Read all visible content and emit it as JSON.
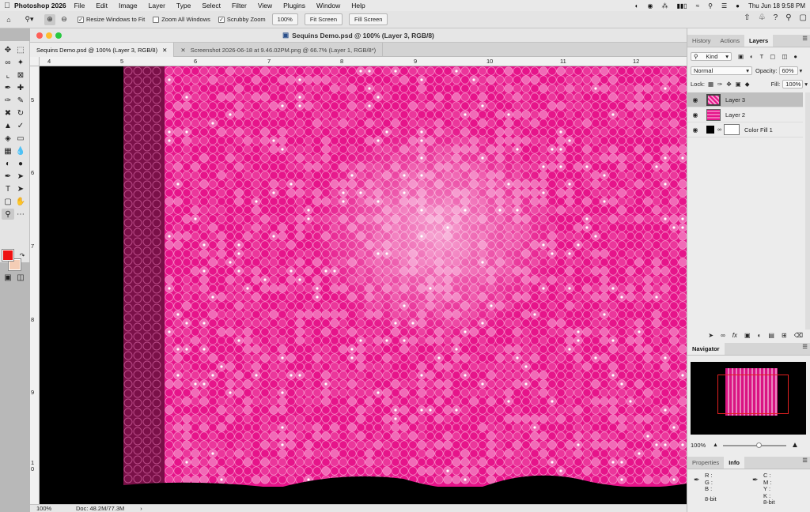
{
  "menubar": {
    "app_name": "Photoshop 2026",
    "items": [
      "File",
      "Edit",
      "Image",
      "Layer",
      "Type",
      "Select",
      "Filter",
      "View",
      "Plugins",
      "Window",
      "Help"
    ],
    "datetime": "Thu Jun 18  9:58 PM"
  },
  "options": {
    "resize_windows": "Resize Windows to Fit",
    "zoom_all": "Zoom All Windows",
    "scrubby": "Scrubby Zoom",
    "zoom_value": "100%",
    "fit_screen": "Fit Screen",
    "fill_screen": "Fill Screen"
  },
  "document": {
    "title": "Sequins Demo.psd @ 100% (Layer 3, RGB/8)",
    "tabs": [
      {
        "label": "Sequins Demo.psd @ 100% (Layer 3, RGB/8)",
        "active": true
      },
      {
        "label": "Screenshot 2026-06-18 at 9.46.02PM.png @ 66.7% (Layer 1, RGB/8*)",
        "active": false
      }
    ],
    "ruler_h": [
      "4",
      "5",
      "6",
      "7",
      "8",
      "9",
      "10",
      "11",
      "12"
    ],
    "ruler_v": [
      "5",
      "6",
      "7",
      "8",
      "9",
      "1\n0"
    ],
    "zoom": "100%",
    "doc_size": "Doc: 48.2M/77.3M"
  },
  "colors": {
    "foreground": "#ee1111",
    "background": "#f4cdb5",
    "sequin": "#e6148a",
    "sequin_light": "#f47ac0",
    "sequin_dark": "#7a1048"
  },
  "panels": {
    "top_tabs": [
      "History",
      "Actions",
      "Layers"
    ],
    "filter_kind": "Kind",
    "blend_mode": "Normal",
    "opacity_label": "Opacity:",
    "opacity_value": "60%",
    "lock_label": "Lock:",
    "fill_label": "Fill:",
    "fill_value": "100%",
    "layers": [
      {
        "name": "Layer 3",
        "active": true
      },
      {
        "name": "Layer 2",
        "active": false
      },
      {
        "name": "Color Fill 1",
        "active": false
      }
    ],
    "navigator_title": "Navigator",
    "navigator_zoom": "100%",
    "info_tabs": [
      "Properties",
      "Info"
    ],
    "info_left": [
      "R :",
      "G :",
      "B :",
      "8-bit"
    ],
    "info_right": [
      "C :",
      "M :",
      "Y :",
      "K :",
      "8-bit"
    ]
  }
}
